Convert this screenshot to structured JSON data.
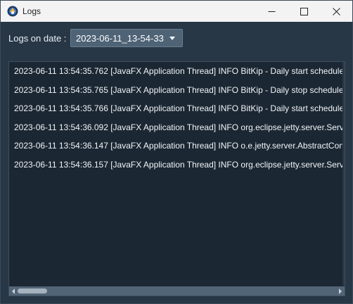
{
  "window": {
    "title": "Logs",
    "icon": "bitkip-app-icon",
    "controls": {
      "minimize_icon": "minimize-icon",
      "maximize_icon": "maximize-icon",
      "close_icon": "close-icon"
    }
  },
  "toolbar": {
    "date_label": "Logs on date :",
    "selected_date": "2023-06-11_13-54-33"
  },
  "log": {
    "lines": [
      "2023-06-11 13:54:35.762 [JavaFX Application Thread] INFO  BitKip - Daily start scheduler w",
      "2023-06-11 13:54:35.765 [JavaFX Application Thread] INFO  BitKip - Daily stop scheduler w",
      "2023-06-11 13:54:35.766 [JavaFX Application Thread] INFO  BitKip - Daily start scheduler w",
      "2023-06-11 13:54:36.092 [JavaFX Application Thread] INFO  org.eclipse.jetty.server.Server",
      "2023-06-11 13:54:36.147 [JavaFX Application Thread] INFO  o.e.jetty.server.AbstractConne",
      "2023-06-11 13:54:36.157 [JavaFX Application Thread] INFO  org.eclipse.jetty.server.Server"
    ]
  },
  "colors": {
    "background": "#283746",
    "log_background": "#1b2733",
    "select_background": "#4f6376",
    "text": "#f1f4f7"
  }
}
